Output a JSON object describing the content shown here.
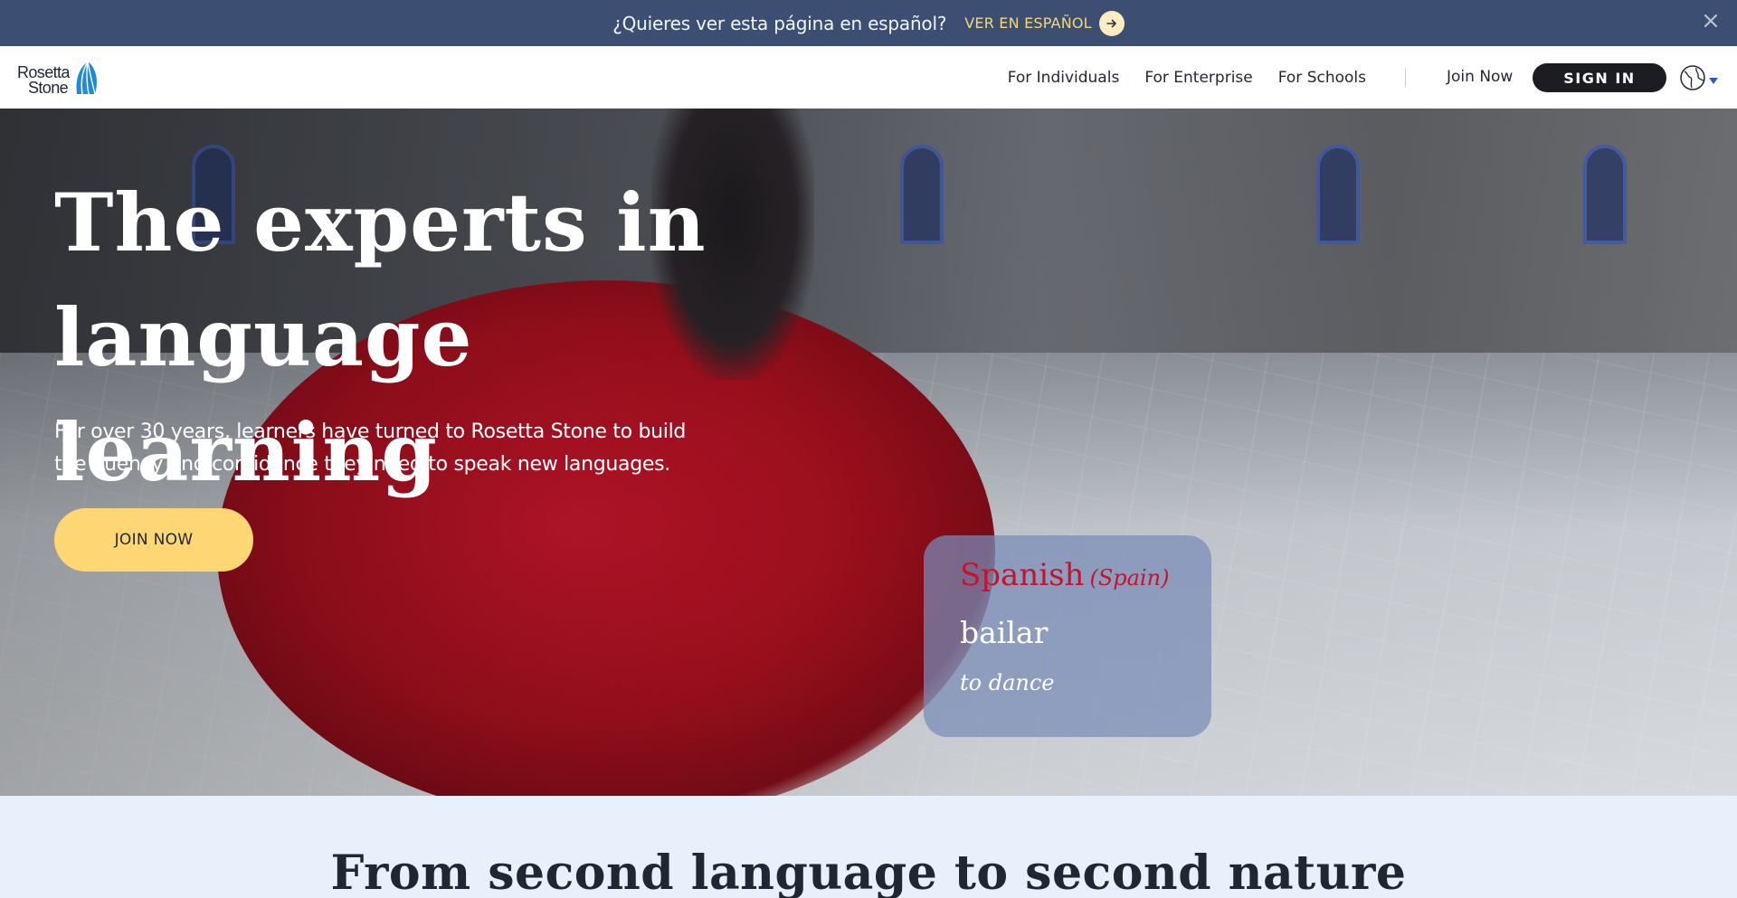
{
  "banner": {
    "prompt": "¿Quieres ver esta página en español?",
    "cta_label": "VER EN ESPAÑOL",
    "cta_icon": "arrow-right-icon",
    "close_icon": "close-icon"
  },
  "nav": {
    "logo": {
      "line1": "Rosetta",
      "line2": "Stone",
      "mark_icon": "rosetta-stone-logo-icon"
    },
    "links": [
      {
        "label": "For Individuals"
      },
      {
        "label": "For Enterprise"
      },
      {
        "label": "For Schools"
      }
    ],
    "join_label": "Join Now",
    "signin_label": "SIGN IN",
    "globe_icon": "globe-icon"
  },
  "hero": {
    "title_line1": "The experts in",
    "title_line2": "language learning",
    "subtitle": "For over 30 years, learners have turned to Rosetta Stone to build the fluency and confidence they need to speak new languages.",
    "cta_label": "JOIN NOW"
  },
  "word_card": {
    "language": "Spanish",
    "variant": "(Spain)",
    "word": "bailar",
    "translation": "to dance"
  },
  "section": {
    "title": "From second language to second nature"
  },
  "colors": {
    "banner_bg": "#3c4f72",
    "banner_cta": "#f4d77a",
    "cta_yellow": "#fed673",
    "signin_bg": "#1b1d22",
    "language_red": "#c4142c",
    "section_bg": "#e8f0fc"
  }
}
